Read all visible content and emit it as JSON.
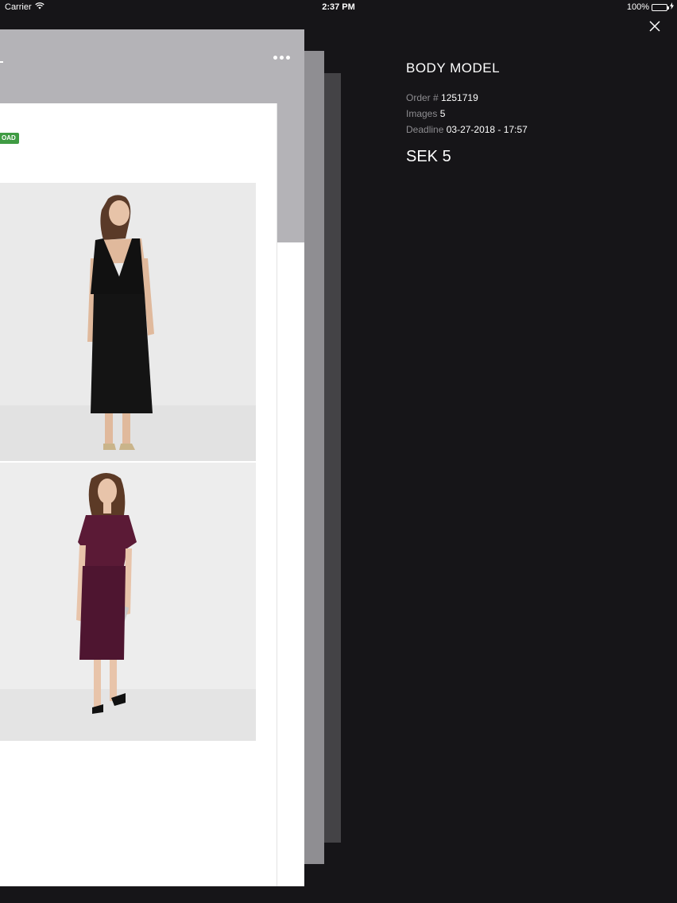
{
  "status_bar": {
    "carrier": "Carrier",
    "time": "2:37 PM",
    "battery_percent": "100%",
    "wifi_icon": "wifi-icon",
    "battery_icon": "battery-icon",
    "charging_icon": "charging-bolt-icon",
    "battery_level": 1.0,
    "battery_color": "#4cd964"
  },
  "card": {
    "badge_label": "OAD",
    "badge_color": "#3f9b43",
    "more_icon": "more-dots-icon",
    "photos": [
      {
        "subject": "model in black backless jumpsuit",
        "icon": "photo-model-black"
      },
      {
        "subject": "model in burgundy lace dress",
        "icon": "photo-model-burgundy"
      }
    ]
  },
  "info": {
    "title": "BODY MODEL",
    "order_label": "Order #",
    "order_value": "1251719",
    "images_label": "Images",
    "images_value": "5",
    "deadline_label": "Deadline",
    "deadline_value": "03-27-2018 - 17:57",
    "price": "SEK 5"
  },
  "close_icon": "close-icon",
  "colors": {
    "background": "#161518",
    "header_gray": "#b4b3b7",
    "muted_text": "#8d8c90"
  }
}
